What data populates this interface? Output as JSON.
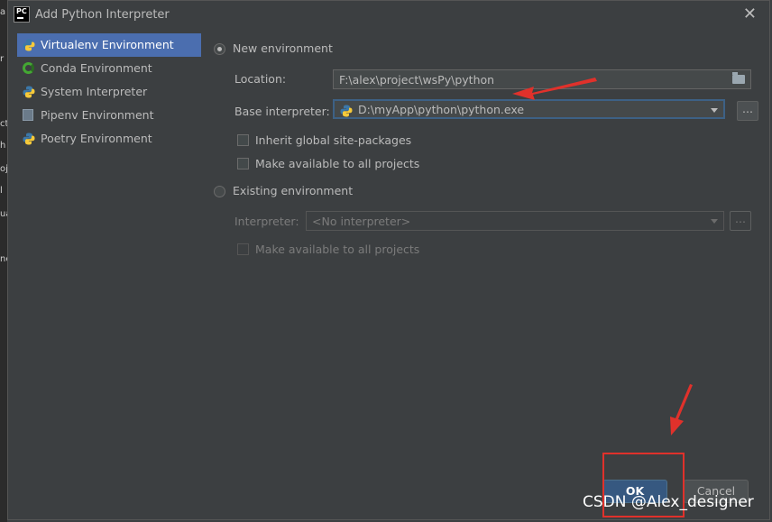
{
  "background_strip": [
    "a",
    "r",
    "ct",
    "h",
    "oj",
    "l",
    "ua",
    "nc"
  ],
  "window": {
    "title": "Add Python Interpreter",
    "app_icon_text": "PC"
  },
  "sidebar": {
    "items": [
      {
        "label": "Virtualenv Environment",
        "icon": "python-icon",
        "selected": true
      },
      {
        "label": "Conda Environment",
        "icon": "conda-icon",
        "selected": false
      },
      {
        "label": "System Interpreter",
        "icon": "python-icon",
        "selected": false
      },
      {
        "label": "Pipenv Environment",
        "icon": "pipenv-icon",
        "selected": false
      },
      {
        "label": "Poetry Environment",
        "icon": "python-icon",
        "selected": false
      }
    ]
  },
  "new_env": {
    "label": "New environment",
    "selected": true,
    "location_label": "Location:",
    "location_value": "F:\\alex\\project\\wsPy\\python",
    "base_label": "Base interpreter:",
    "base_value": "D:\\myApp\\python\\python.exe",
    "browse_label": "...",
    "inherit_label": "Inherit global site-packages",
    "make_available_label": "Make available to all projects"
  },
  "existing_env": {
    "label": "Existing environment",
    "selected": false,
    "interpreter_label": "Interpreter:",
    "interpreter_value": "<No interpreter>",
    "browse_label": "...",
    "make_available_label": "Make available to all projects"
  },
  "buttons": {
    "ok": "OK",
    "cancel": "Cancel"
  },
  "watermark": "CSDN @Alex_designer",
  "colors": {
    "accent": "#4b6eaf",
    "annotation": "#e0312b",
    "ok_button": "#365880"
  }
}
